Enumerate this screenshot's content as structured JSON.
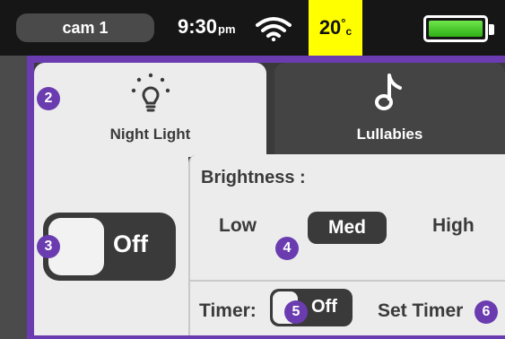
{
  "status_bar": {
    "camera": "cam 1",
    "time": "9:30",
    "ampm": "pm",
    "temperature": "20",
    "temp_degree": "°",
    "temp_unit": "c",
    "wifi_icon": "wifi-icon",
    "battery_icon": "battery-icon",
    "battery_level": 1.0
  },
  "tabs": [
    {
      "label": "Night Light",
      "icon": "lightbulb-icon",
      "selected": true
    },
    {
      "label": "Lullabies",
      "icon": "music-note-icon",
      "selected": false
    }
  ],
  "night_light": {
    "power_state": "Off"
  },
  "brightness": {
    "title": "Brightness :",
    "options": [
      "Low",
      "Med",
      "High"
    ],
    "selected": "Med"
  },
  "timer": {
    "label": "Timer:",
    "state": "Off",
    "set_label": "Set Timer"
  },
  "callouts": [
    "2",
    "3",
    "4",
    "5",
    "6"
  ],
  "colors": {
    "accent_purple": "#6a3cb0",
    "temp_highlight": "#ffff00",
    "battery_green": "#3cc321",
    "dark": "#3a3a3a",
    "panel": "#ececec"
  }
}
